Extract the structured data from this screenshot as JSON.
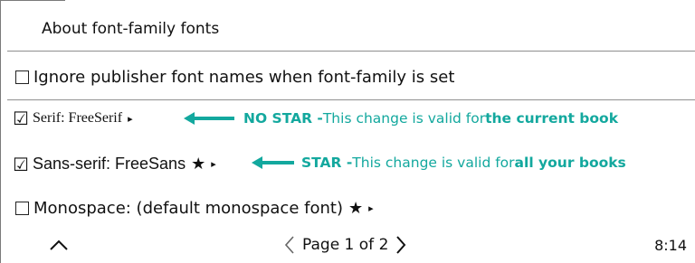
{
  "menu": {
    "title": "About font-family fonts",
    "items": [
      {
        "checked": false,
        "label": "Ignore publisher font names when font-family is set"
      },
      {
        "checked": true,
        "label": "Serif: FreeSerif",
        "star": "",
        "submenu": "▸"
      },
      {
        "checked": true,
        "label": "Sans-serif: FreeSans",
        "star": "★",
        "submenu": "▸"
      },
      {
        "checked": false,
        "label": "Monospace: (default monospace font)",
        "star": "★",
        "submenu": "▸"
      }
    ]
  },
  "annotations": [
    {
      "head": "NO STAR - ",
      "text": "This change is valid for ",
      "emphasis": "the current book"
    },
    {
      "head": "STAR - ",
      "text": "This change is valid for ",
      "emphasis": "all your books"
    }
  ],
  "footer": {
    "page_label": "Page 1 of 2",
    "time": "8:14"
  },
  "colors": {
    "annotation": "#13a89e",
    "text": "#111111",
    "divider": "#8f8f8f"
  },
  "icons": {
    "up": "chevron-up-icon",
    "prev": "chevron-left-icon",
    "next": "chevron-right-icon",
    "checked": "checkbox-checked-icon",
    "unchecked": "checkbox-unchecked-icon"
  }
}
